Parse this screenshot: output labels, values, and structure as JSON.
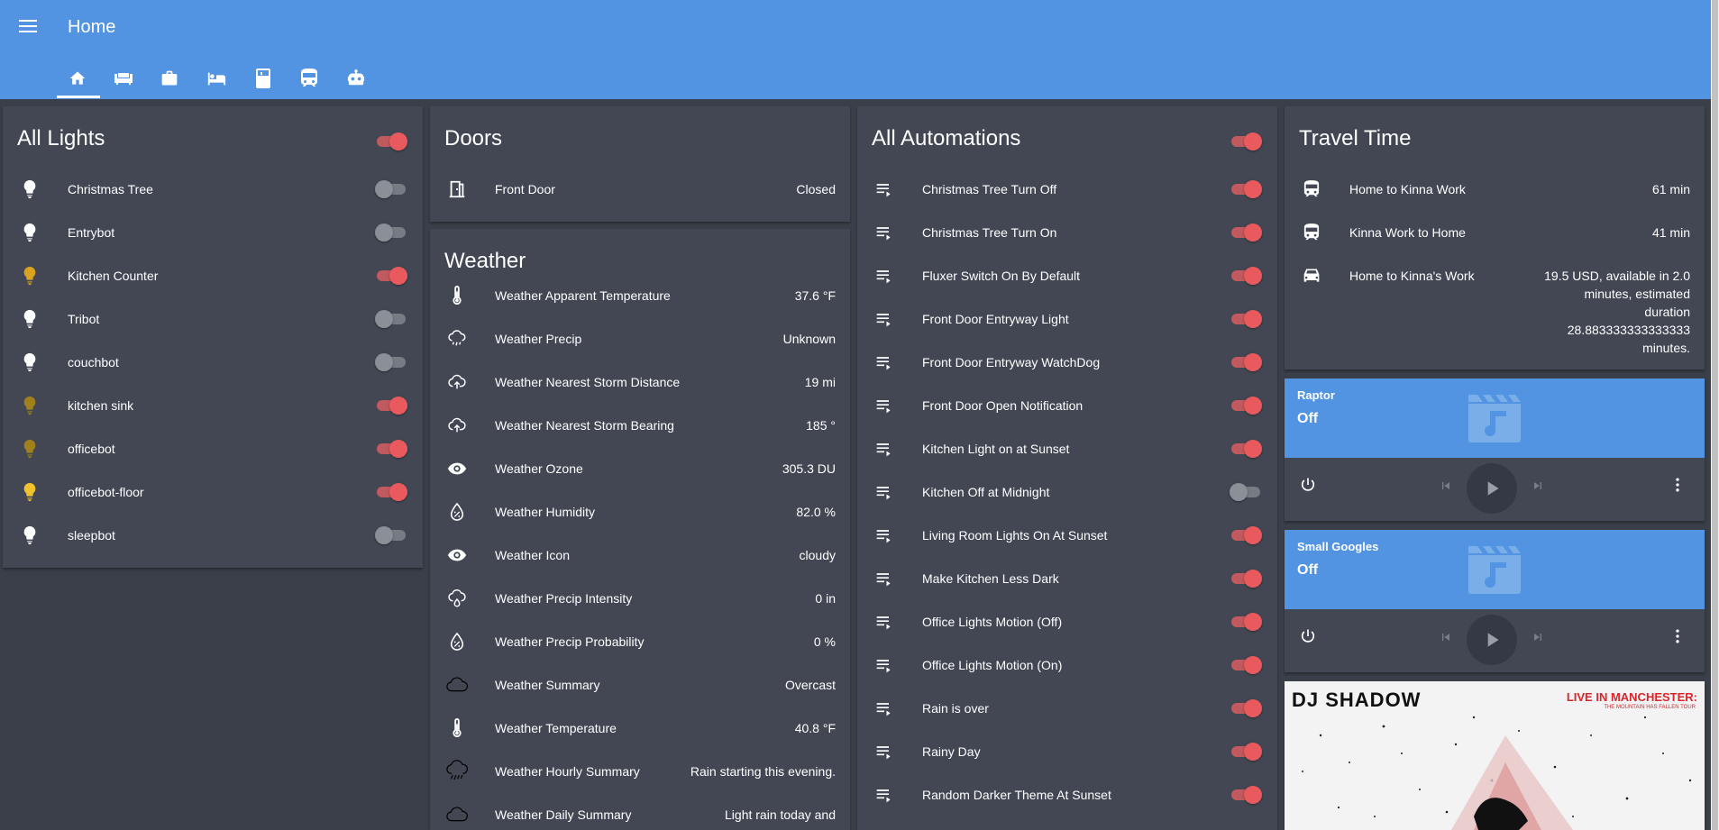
{
  "app": {
    "title": "Home"
  },
  "tabs": [
    {
      "icon": "home-icon",
      "active": true
    },
    {
      "icon": "sofa-icon"
    },
    {
      "icon": "briefcase-icon"
    },
    {
      "icon": "bed-icon"
    },
    {
      "icon": "fridge-icon"
    },
    {
      "icon": "train-icon"
    },
    {
      "icon": "robot-icon"
    }
  ],
  "lights": {
    "title": "All Lights",
    "master_on": true,
    "items": [
      {
        "label": "Christmas Tree",
        "on": false,
        "icon": "bulb-icon",
        "icon_color": "#ffffff"
      },
      {
        "label": "Entrybot",
        "on": false,
        "icon": "bulb-icon",
        "icon_color": "#ffffff"
      },
      {
        "label": "Kitchen Counter",
        "on": true,
        "icon": "bulb-icon",
        "icon_color": "#d9a31f"
      },
      {
        "label": "Tribot",
        "on": false,
        "icon": "bulb-icon",
        "icon_color": "#ffffff"
      },
      {
        "label": "couchbot",
        "on": false,
        "icon": "bulb-icon",
        "icon_color": "#ffffff"
      },
      {
        "label": "kitchen sink",
        "on": true,
        "icon": "bulb-icon",
        "icon_color": "#a0801c"
      },
      {
        "label": "officebot",
        "on": true,
        "icon": "bulb-icon",
        "icon_color": "#a0801c"
      },
      {
        "label": "officebot-floor",
        "on": true,
        "icon": "bulb-icon",
        "icon_color": "#f2c12e"
      },
      {
        "label": "sleepbot",
        "on": false,
        "icon": "bulb-icon",
        "icon_color": "#ffffff"
      }
    ]
  },
  "doors": {
    "title": "Doors",
    "items": [
      {
        "label": "Front Door",
        "value": "Closed",
        "icon": "door-icon"
      }
    ]
  },
  "weather": {
    "title": "Weather",
    "items": [
      {
        "label": "Weather Apparent Temperature",
        "value": "37.6 °F",
        "icon": "thermometer-icon"
      },
      {
        "label": "Weather Precip",
        "value": "Unknown",
        "icon": "rain-icon"
      },
      {
        "label": "Weather Nearest Storm Distance",
        "value": "19 mi",
        "icon": "cloud-upload-icon"
      },
      {
        "label": "Weather Nearest Storm Bearing",
        "value": "185 °",
        "icon": "cloud-upload-icon"
      },
      {
        "label": "Weather Ozone",
        "value": "305.3 DU",
        "icon": "eye-icon"
      },
      {
        "label": "Weather Humidity",
        "value": "82.0 %",
        "icon": "water-percent-icon"
      },
      {
        "label": "Weather Icon",
        "value": "cloudy",
        "icon": "eye-icon"
      },
      {
        "label": "Weather Precip Intensity",
        "value": "0 in",
        "icon": "cloud-drop-icon"
      },
      {
        "label": "Weather Precip Probability",
        "value": "0 %",
        "icon": "water-percent-icon"
      },
      {
        "label": "Weather Summary",
        "value": "Overcast",
        "icon": "cloud-icon"
      },
      {
        "label": "Weather Temperature",
        "value": "40.8 °F",
        "icon": "thermometer-icon"
      },
      {
        "label": "Weather Hourly Summary",
        "value": "Rain starting this evening.",
        "icon": "rain-heavy-icon"
      },
      {
        "label": "Weather Daily Summary",
        "value": "Light rain today and",
        "icon": "cloud-icon"
      }
    ]
  },
  "automations": {
    "title": "All Automations",
    "master_on": true,
    "items": [
      {
        "label": "Christmas Tree Turn Off",
        "on": true
      },
      {
        "label": "Christmas Tree Turn On",
        "on": true
      },
      {
        "label": "Fluxer Switch On By Default",
        "on": true
      },
      {
        "label": "Front Door Entryway Light",
        "on": true
      },
      {
        "label": "Front Door Entryway WatchDog",
        "on": true
      },
      {
        "label": "Front Door Open Notification",
        "on": true
      },
      {
        "label": "Kitchen Light on at Sunset",
        "on": true
      },
      {
        "label": "Kitchen Off at Midnight",
        "on": false
      },
      {
        "label": "Living Room Lights On At Sunset",
        "on": true
      },
      {
        "label": "Make Kitchen Less Dark",
        "on": true
      },
      {
        "label": "Office Lights Motion (Off)",
        "on": true
      },
      {
        "label": "Office Lights Motion (On)",
        "on": true
      },
      {
        "label": "Rain is over",
        "on": true
      },
      {
        "label": "Rainy Day",
        "on": true
      },
      {
        "label": "Random Darker Theme At Sunset",
        "on": true
      }
    ]
  },
  "travel": {
    "title": "Travel Time",
    "items": [
      {
        "label": "Home to Kinna Work",
        "value": "61 min",
        "icon": "train-icon"
      },
      {
        "label": "Kinna Work to Home",
        "value": "41 min",
        "icon": "train-icon"
      },
      {
        "label": "Home to Kinna's Work",
        "icon": "car-icon",
        "value_lines": [
          "19.5 USD, available in 2.0",
          "minutes, estimated",
          "duration",
          "28.883333333333333",
          "minutes."
        ]
      }
    ]
  },
  "media": [
    {
      "name": "Raptor",
      "state": "Off"
    },
    {
      "name": "Small Googles",
      "state": "Off"
    }
  ],
  "album": {
    "artist": "DJ SHADOW",
    "headline": "LIVE IN MANCHESTER:",
    "subline": "THE MOUNTAIN HAS FALLEN TOUR"
  },
  "colors": {
    "header": "#5294e2",
    "card": "#424753",
    "background": "#3a3f49",
    "toggle_on": "#e85a5e"
  }
}
